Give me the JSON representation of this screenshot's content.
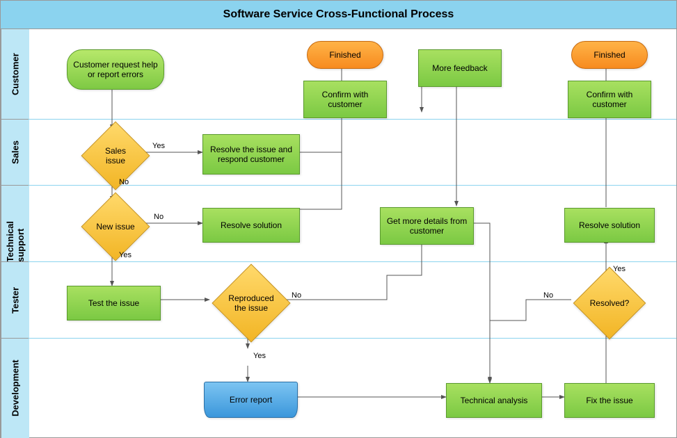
{
  "title": "Software Service Cross-Functional Process",
  "lanes": [
    {
      "label": "Customer"
    },
    {
      "label": "Sales"
    },
    {
      "label": "Technical support"
    },
    {
      "label": "Tester"
    },
    {
      "label": "Development"
    }
  ],
  "nodes": {
    "start": "Customer request help or report errors",
    "finished1": "Finished",
    "finished2": "Finished",
    "confirm1": "Confirm with customer",
    "confirm2": "Confirm with customer",
    "more_feedback": "More feedback",
    "sales_issue": "Sales issue",
    "resolve_respond": "Resolve the issue and respond customer",
    "new_issue": "New issue",
    "resolve_solution1": "Resolve solution",
    "resolve_solution2": "Resolve solution",
    "get_details": "Get more details from customer",
    "test_issue": "Test the issue",
    "reproduced": "Reproduced the issue",
    "resolved": "Resolved?",
    "error_report": "Error report",
    "tech_analysis": "Technical analysis",
    "fix_issue": "Fix the issue"
  },
  "edge_labels": {
    "yes1": "Yes",
    "no1": "No",
    "yes2": "Yes",
    "no2": "No",
    "yes3": "Yes",
    "no3": "No",
    "yes4": "Yes",
    "no4": "No"
  },
  "chart_data": {
    "type": "table",
    "swimlanes": [
      "Customer",
      "Sales",
      "Technical support",
      "Tester",
      "Development"
    ],
    "shapes": [
      {
        "id": "start",
        "lane": "Customer",
        "kind": "terminator",
        "label": "Customer request help or report errors"
      },
      {
        "id": "finished1",
        "lane": "Customer",
        "kind": "terminator-end",
        "label": "Finished"
      },
      {
        "id": "confirm1",
        "lane": "Customer",
        "kind": "process",
        "label": "Confirm with customer"
      },
      {
        "id": "more_feedback",
        "lane": "Customer",
        "kind": "process",
        "label": "More feedback"
      },
      {
        "id": "finished2",
        "lane": "Customer",
        "kind": "terminator-end",
        "label": "Finished"
      },
      {
        "id": "confirm2",
        "lane": "Customer",
        "kind": "process",
        "label": "Confirm with customer"
      },
      {
        "id": "sales_issue",
        "lane": "Sales",
        "kind": "decision",
        "label": "Sales issue"
      },
      {
        "id": "resolve_respond",
        "lane": "Sales",
        "kind": "process",
        "label": "Resolve the issue and respond customer"
      },
      {
        "id": "new_issue",
        "lane": "Technical support",
        "kind": "decision",
        "label": "New issue"
      },
      {
        "id": "resolve_solution1",
        "lane": "Technical support",
        "kind": "process",
        "label": "Resolve solution"
      },
      {
        "id": "get_details",
        "lane": "Technical support",
        "kind": "process",
        "label": "Get more details from customer"
      },
      {
        "id": "resolve_solution2",
        "lane": "Technical support",
        "kind": "process",
        "label": "Resolve solution"
      },
      {
        "id": "test_issue",
        "lane": "Tester",
        "kind": "process",
        "label": "Test the issue"
      },
      {
        "id": "reproduced",
        "lane": "Tester",
        "kind": "decision",
        "label": "Reproduced the issue"
      },
      {
        "id": "resolved",
        "lane": "Tester",
        "kind": "decision",
        "label": "Resolved?"
      },
      {
        "id": "error_report",
        "lane": "Development",
        "kind": "document",
        "label": "Error report"
      },
      {
        "id": "tech_analysis",
        "lane": "Development",
        "kind": "process",
        "label": "Technical analysis"
      },
      {
        "id": "fix_issue",
        "lane": "Development",
        "kind": "process",
        "label": "Fix the issue"
      }
    ],
    "edges": [
      {
        "from": "start",
        "to": "sales_issue"
      },
      {
        "from": "sales_issue",
        "to": "resolve_respond",
        "label": "Yes"
      },
      {
        "from": "sales_issue",
        "to": "new_issue",
        "label": "No"
      },
      {
        "from": "resolve_respond",
        "to": "confirm1"
      },
      {
        "from": "confirm1",
        "to": "finished1"
      },
      {
        "from": "new_issue",
        "to": "resolve_solution1",
        "label": "No"
      },
      {
        "from": "new_issue",
        "to": "test_issue",
        "label": "Yes"
      },
      {
        "from": "resolve_solution1",
        "to": "confirm1"
      },
      {
        "from": "test_issue",
        "to": "reproduced"
      },
      {
        "from": "reproduced",
        "to": "error_report",
        "label": "Yes"
      },
      {
        "from": "reproduced",
        "to": "get_details",
        "label": "No"
      },
      {
        "from": "get_details",
        "to": "more_feedback"
      },
      {
        "from": "more_feedback",
        "to": "get_details"
      },
      {
        "from": "get_details",
        "to": "tech_analysis"
      },
      {
        "from": "error_report",
        "to": "tech_analysis"
      },
      {
        "from": "tech_analysis",
        "to": "fix_issue"
      },
      {
        "from": "fix_issue",
        "to": "resolved"
      },
      {
        "from": "resolved",
        "to": "resolve_solution2",
        "label": "Yes"
      },
      {
        "from": "resolved",
        "to": "tech_analysis",
        "label": "No"
      },
      {
        "from": "resolve_solution2",
        "to": "confirm2"
      },
      {
        "from": "confirm2",
        "to": "finished2"
      }
    ]
  }
}
